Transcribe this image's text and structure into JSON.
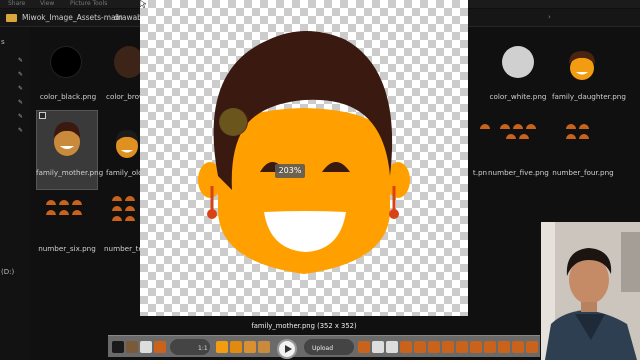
{
  "menubar": {
    "items": [
      "Share",
      "View",
      "Picture Tools"
    ]
  },
  "address": {
    "segments": [
      "Miwok_Image_Assets-main",
      "drawabl"
    ]
  },
  "sidebar": {
    "drive_label": "(D:)"
  },
  "files": [
    {
      "name": "color_black.png"
    },
    {
      "name": "color_brow"
    },
    {
      "name": "color_white.png"
    },
    {
      "name": "family_daughter.png"
    },
    {
      "name": "family_mother.png"
    },
    {
      "name": "family_older_brother.png"
    },
    {
      "name": "number_five.png"
    },
    {
      "name": "number_four.png"
    },
    {
      "name": "number_six.png"
    },
    {
      "name": "number_te"
    },
    {
      "name": "t.pn"
    }
  ],
  "viewer": {
    "zoom_label": "203%",
    "caption": "family_mother.png (352 x 352)"
  },
  "filmstrip": {
    "page_label": "1:1",
    "upload_label": "Upload"
  },
  "colors": {
    "face": "#FF9F00",
    "hair": "#3A1A10",
    "earring": "#D84315",
    "bun": "#5A2A10",
    "checker": "#cccccc",
    "folder": "#d8a63a"
  }
}
